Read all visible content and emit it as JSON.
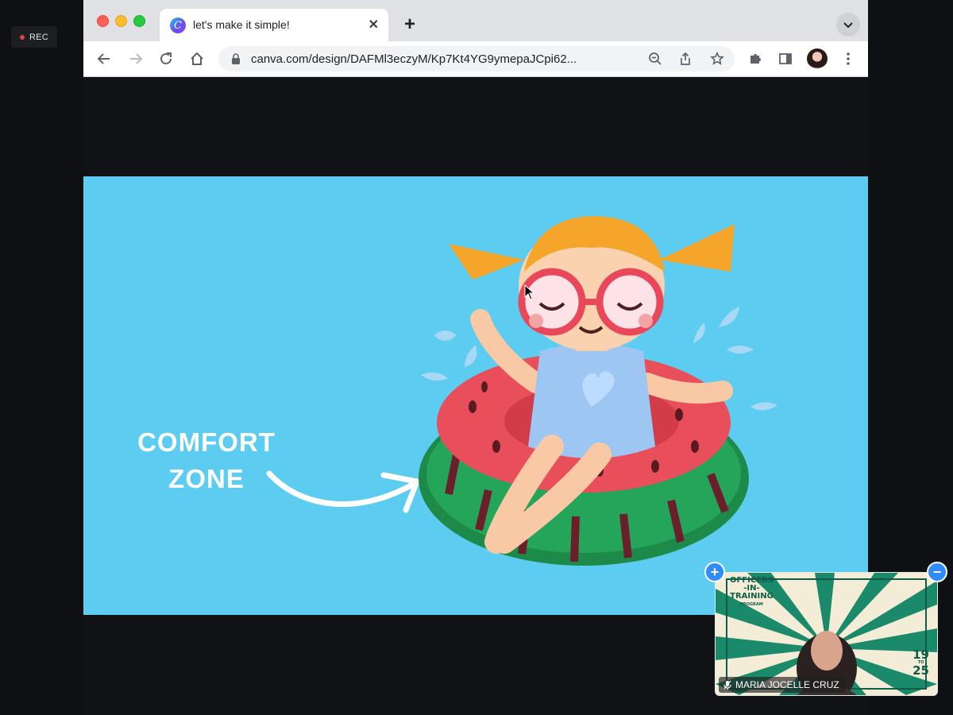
{
  "recording": {
    "label": "REC"
  },
  "browser": {
    "tab": {
      "title": "let's make it simple!",
      "favicon_letter": "C"
    },
    "address_bar": {
      "url": "canva.com/design/DAFMl3eczyM/Kp7Kt4YG9ymepaJCpi62..."
    }
  },
  "slide": {
    "caption_line1": "COMFORT",
    "caption_line2": "ZONE",
    "colors": {
      "background": "#5ccdf0",
      "text": "#ffffff"
    }
  },
  "video_tile": {
    "participant_name": "MARIA JOCELLE CRUZ",
    "background_title_line1": "OFFICERS",
    "background_title_line2": "-IN-",
    "background_title_line3": "TRAINING",
    "background_title_line4": "PROGRAM",
    "background_number_top": "19",
    "background_number_mid": "TO",
    "background_number_bottom": "25",
    "colors": {
      "green": "#1a8a6a",
      "cream": "#f3ecd6"
    }
  }
}
